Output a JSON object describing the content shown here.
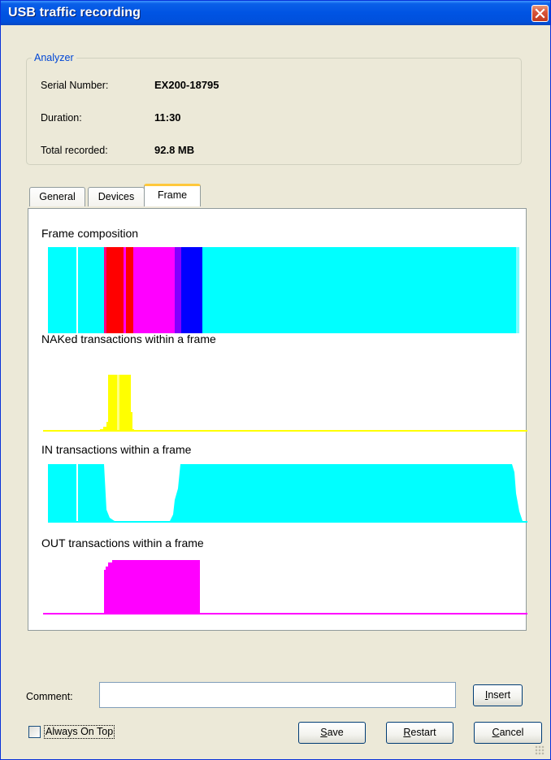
{
  "window": {
    "title": "USB traffic recording",
    "close_icon": "close-icon"
  },
  "analyzer": {
    "legend": "Analyzer",
    "rows": [
      {
        "label": "Serial Number:",
        "value": "EX200-18795"
      },
      {
        "label": "Duration:",
        "value": "11:30"
      },
      {
        "label": "Total recorded:",
        "value": "92.8 MB"
      }
    ]
  },
  "tabs": [
    {
      "label": "General",
      "active": false
    },
    {
      "label": "Devices",
      "active": false
    },
    {
      "label": "Frame",
      "active": true
    }
  ],
  "frame_panel": {
    "sections": [
      {
        "title": "Frame composition",
        "color": "#00ffff"
      },
      {
        "title": "NAKed transactions within a frame",
        "color": "#ffff00"
      },
      {
        "title": "IN transactions within a frame",
        "color": "#00ffff"
      },
      {
        "title": "OUT transactions within a frame",
        "color": "#ff00ff"
      }
    ],
    "colors": {
      "cyan": "#00ffff",
      "red": "#ff0000",
      "magenta": "#ff00ff",
      "blue": "#0000ff",
      "purple": "#8000ff",
      "yellow": "#ffff00"
    }
  },
  "comment": {
    "label": "Comment:",
    "value": ""
  },
  "buttons": {
    "insert": {
      "mnemonic": "I",
      "rest": "nsert"
    },
    "save": {
      "mnemonic": "S",
      "rest": "ave"
    },
    "restart": {
      "mnemonic": "R",
      "rest": "estart"
    },
    "cancel": {
      "mnemonic": "C",
      "rest": "ancel"
    }
  },
  "always_on_top": {
    "label": "Always On Top",
    "checked": false
  }
}
